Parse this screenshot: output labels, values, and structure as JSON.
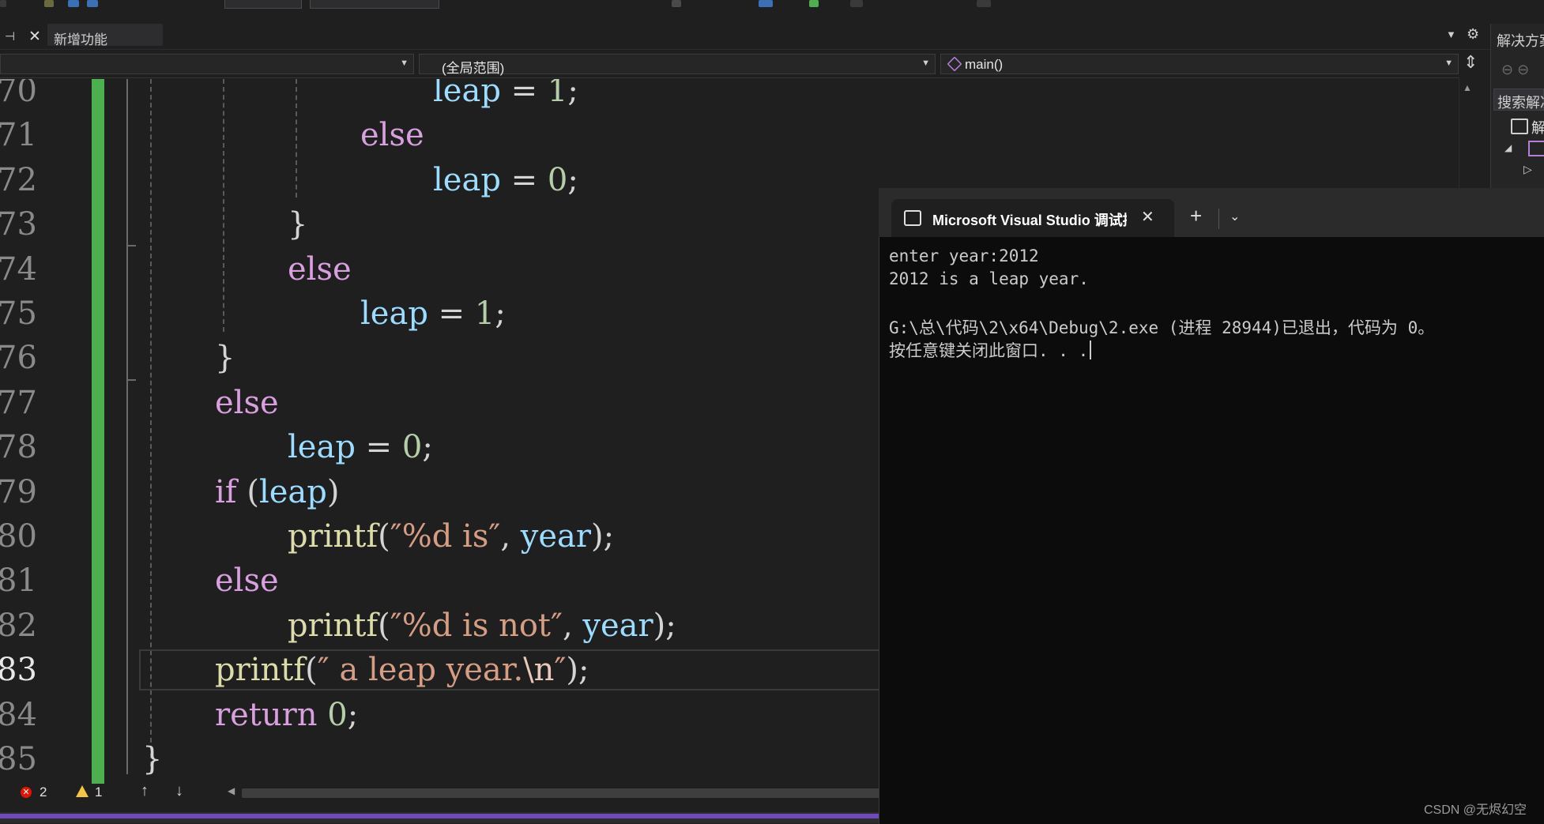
{
  "tabs": {
    "active_tab_label": "新增功能"
  },
  "navbar": {
    "scope": "(全局范围)",
    "member": "main()"
  },
  "editor": {
    "lines": [
      {
        "n": "70",
        "indent": 6,
        "tokens": [
          {
            "t": "leap",
            "c": "var"
          },
          {
            "t": " = ",
            "c": "op"
          },
          {
            "t": "1",
            "c": "num"
          },
          {
            "t": ";",
            "c": "op"
          }
        ]
      },
      {
        "n": "71",
        "indent": 5,
        "tokens": [
          {
            "t": "else",
            "c": "kw"
          }
        ]
      },
      {
        "n": "72",
        "indent": 6,
        "tokens": [
          {
            "t": "leap",
            "c": "var"
          },
          {
            "t": " = ",
            "c": "op"
          },
          {
            "t": "0",
            "c": "num"
          },
          {
            "t": ";",
            "c": "op"
          }
        ]
      },
      {
        "n": "73",
        "indent": 4,
        "tokens": [
          {
            "t": "}",
            "c": "op"
          }
        ]
      },
      {
        "n": "74",
        "indent": 4,
        "tokens": [
          {
            "t": "else",
            "c": "kw"
          }
        ]
      },
      {
        "n": "75",
        "indent": 5,
        "tokens": [
          {
            "t": "leap",
            "c": "var"
          },
          {
            "t": " = ",
            "c": "op"
          },
          {
            "t": "1",
            "c": "num"
          },
          {
            "t": ";",
            "c": "op"
          }
        ]
      },
      {
        "n": "76",
        "indent": 3,
        "tokens": [
          {
            "t": "}",
            "c": "op"
          }
        ]
      },
      {
        "n": "77",
        "indent": 3,
        "tokens": [
          {
            "t": "else",
            "c": "kw"
          }
        ]
      },
      {
        "n": "78",
        "indent": 4,
        "tokens": [
          {
            "t": "leap",
            "c": "var"
          },
          {
            "t": " = ",
            "c": "op"
          },
          {
            "t": "0",
            "c": "num"
          },
          {
            "t": ";",
            "c": "op"
          }
        ]
      },
      {
        "n": "79",
        "indent": 3,
        "tokens": [
          {
            "t": "if",
            "c": "kw"
          },
          {
            "t": " (",
            "c": "op"
          },
          {
            "t": "leap",
            "c": "var"
          },
          {
            "t": ")",
            "c": "op"
          }
        ]
      },
      {
        "n": "80",
        "indent": 4,
        "tokens": [
          {
            "t": "printf",
            "c": "fn"
          },
          {
            "t": "(",
            "c": "op"
          },
          {
            "t": "″%d is″",
            "c": "str"
          },
          {
            "t": ", ",
            "c": "op"
          },
          {
            "t": "year",
            "c": "var"
          },
          {
            "t": ");",
            "c": "op"
          }
        ]
      },
      {
        "n": "81",
        "indent": 3,
        "tokens": [
          {
            "t": "else",
            "c": "kw"
          }
        ]
      },
      {
        "n": "82",
        "indent": 4,
        "tokens": [
          {
            "t": "printf",
            "c": "fn"
          },
          {
            "t": "(",
            "c": "op"
          },
          {
            "t": "″%d is not″",
            "c": "str"
          },
          {
            "t": ", ",
            "c": "op"
          },
          {
            "t": "year",
            "c": "var"
          },
          {
            "t": ");",
            "c": "op"
          }
        ]
      },
      {
        "n": "83",
        "indent": 3,
        "current": true,
        "tokens": [
          {
            "t": "printf",
            "c": "fn"
          },
          {
            "t": "(",
            "c": "op"
          },
          {
            "t": "″ a leap year.",
            "c": "str"
          },
          {
            "t": "\\n",
            "c": "esc"
          },
          {
            "t": "″",
            "c": "str"
          },
          {
            "t": ");",
            "c": "op"
          }
        ]
      },
      {
        "n": "84",
        "indent": 3,
        "tokens": [
          {
            "t": "return",
            "c": "kw"
          },
          {
            "t": " ",
            "c": "op"
          },
          {
            "t": "0",
            "c": "num"
          },
          {
            "t": ";",
            "c": "op"
          }
        ]
      },
      {
        "n": "85",
        "indent": 2,
        "tokens": [
          {
            "t": "}",
            "c": "op"
          }
        ]
      }
    ]
  },
  "status": {
    "errors": "2",
    "warnings": "1",
    "error_glyph": "✕"
  },
  "console": {
    "title": "Microsoft Visual Studio 调试控制台",
    "lines": [
      "enter year:2012",
      "2012 is a leap year.",
      "",
      "G:\\总\\代码\\2\\x64\\Debug\\2.exe (进程 28944)已退出，代码为 0。",
      "按任意键关闭此窗口. . ."
    ]
  },
  "solution_explorer": {
    "title": "解决方案",
    "search": "搜索解决",
    "row1": "解"
  },
  "watermark": "CSDN @无烬幻空",
  "colors": {
    "keyword": "#d8a0df",
    "variable": "#9cdcfe",
    "number": "#b5cea8",
    "string": "#d69d85",
    "changed_margin": "#4caf50",
    "status_accent": "#6f4bb8"
  }
}
